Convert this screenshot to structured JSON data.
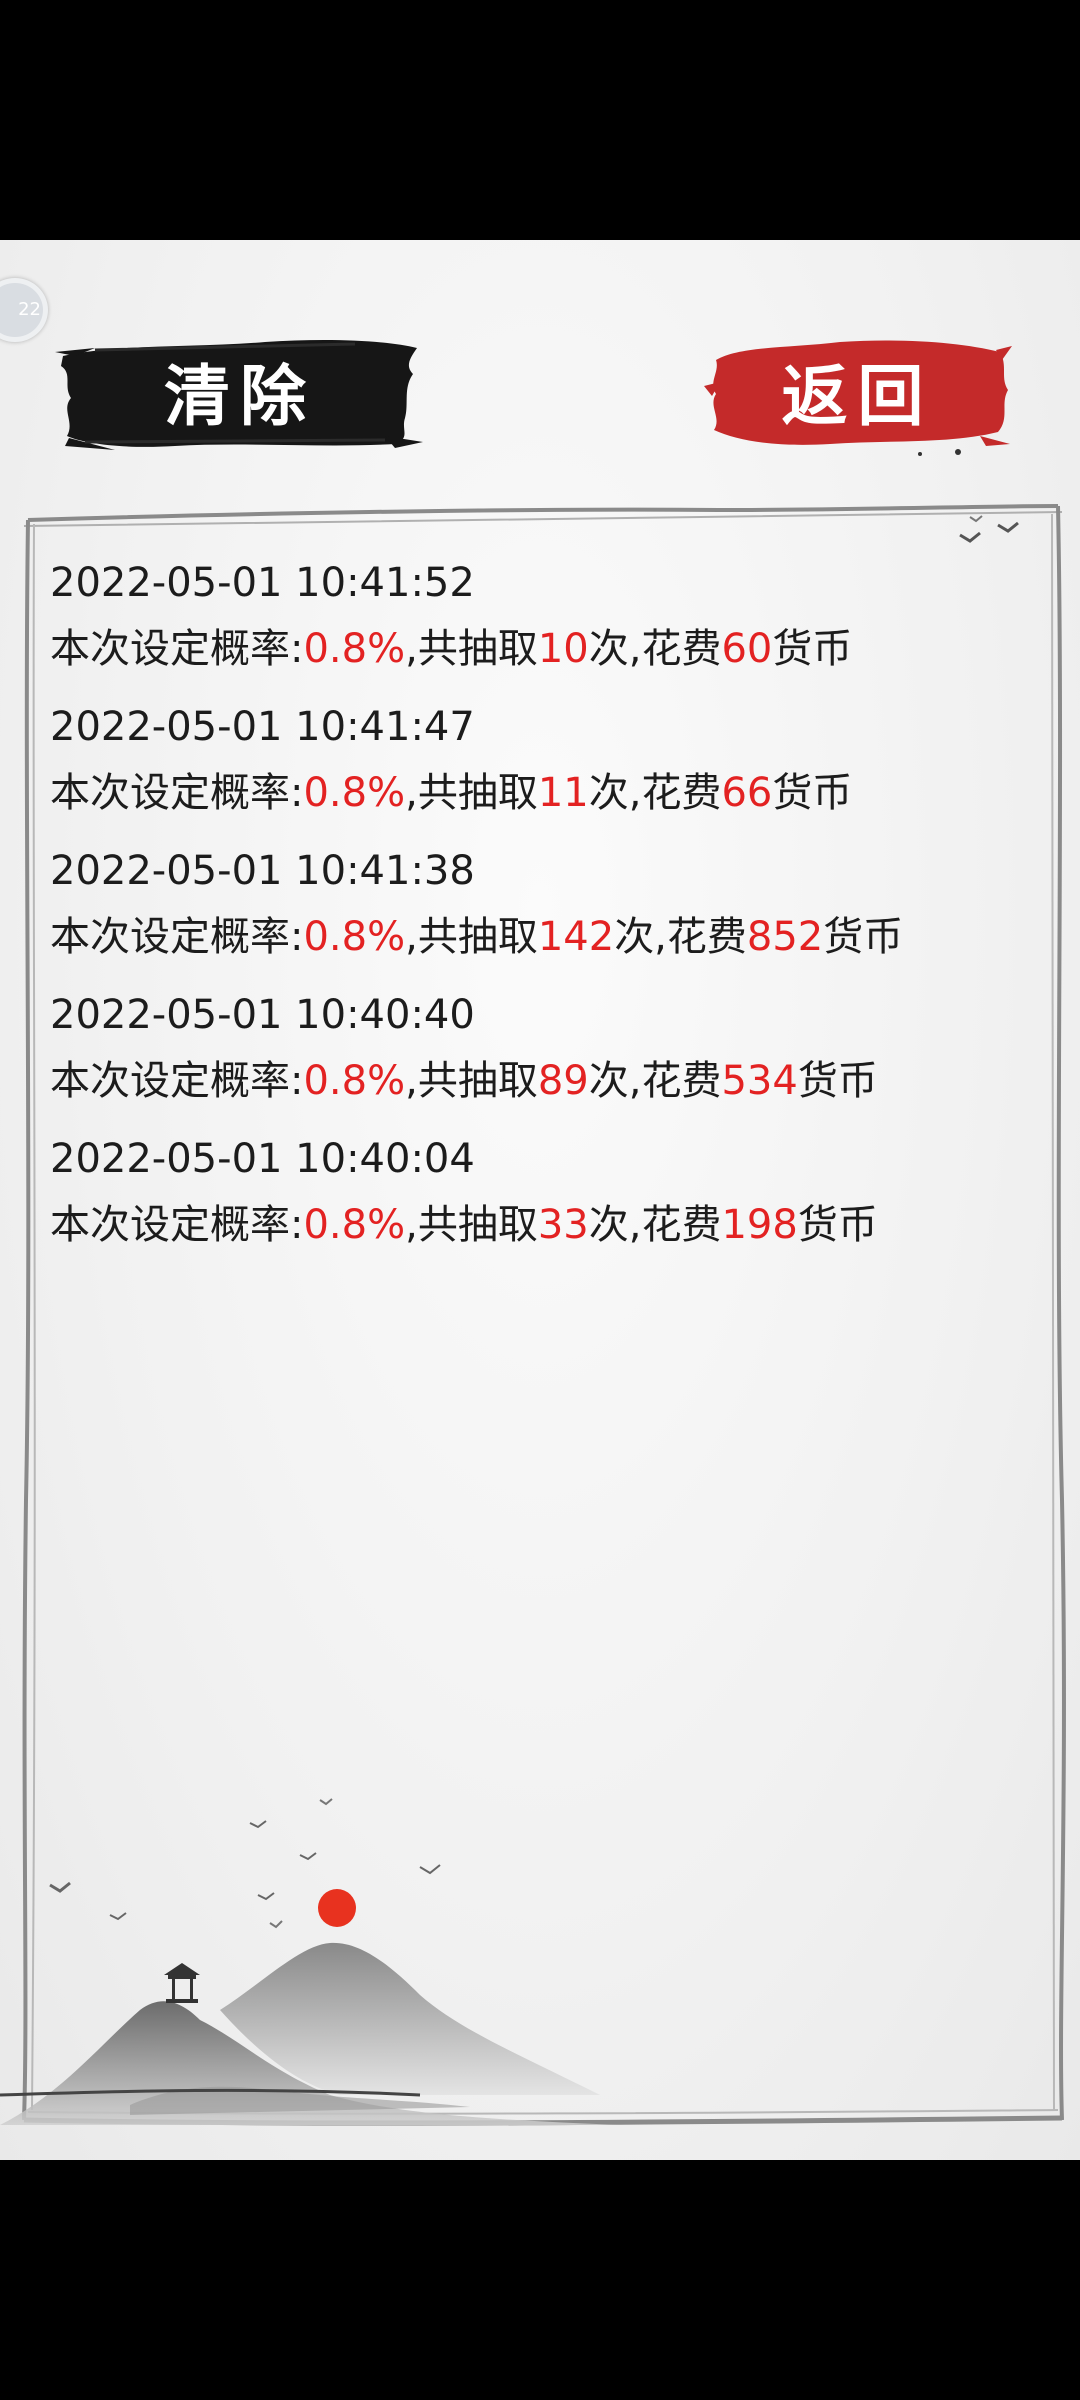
{
  "float_bubble": "22",
  "buttons": {
    "clear_label": "清除",
    "back_label": "返回"
  },
  "colors": {
    "accent_red": "#e32222",
    "back_button": "#c42a2a",
    "clear_button": "#161616",
    "sun": "#e8321f"
  },
  "icons": [
    "floating-ball-icon",
    "birds-icon",
    "sun-icon",
    "pavilion-icon",
    "mountains-icon"
  ],
  "record_labels": {
    "rate_prefix": "本次设定概率:",
    "draw_prefix": ",共抽取",
    "draw_suffix": "次,花费",
    "coin_suffix": "货币"
  },
  "records": [
    {
      "time": "2022-05-01 10:41:52",
      "rate": "0.8%",
      "draws": "10",
      "cost": "60"
    },
    {
      "time": "2022-05-01 10:41:47",
      "rate": "0.8%",
      "draws": "11",
      "cost": "66"
    },
    {
      "time": "2022-05-01 10:41:38",
      "rate": "0.8%",
      "draws": "142",
      "cost": "852"
    },
    {
      "time": "2022-05-01 10:40:40",
      "rate": "0.8%",
      "draws": "89",
      "cost": "534"
    },
    {
      "time": "2022-05-01 10:40:04",
      "rate": "0.8%",
      "draws": "33",
      "cost": "198"
    }
  ]
}
